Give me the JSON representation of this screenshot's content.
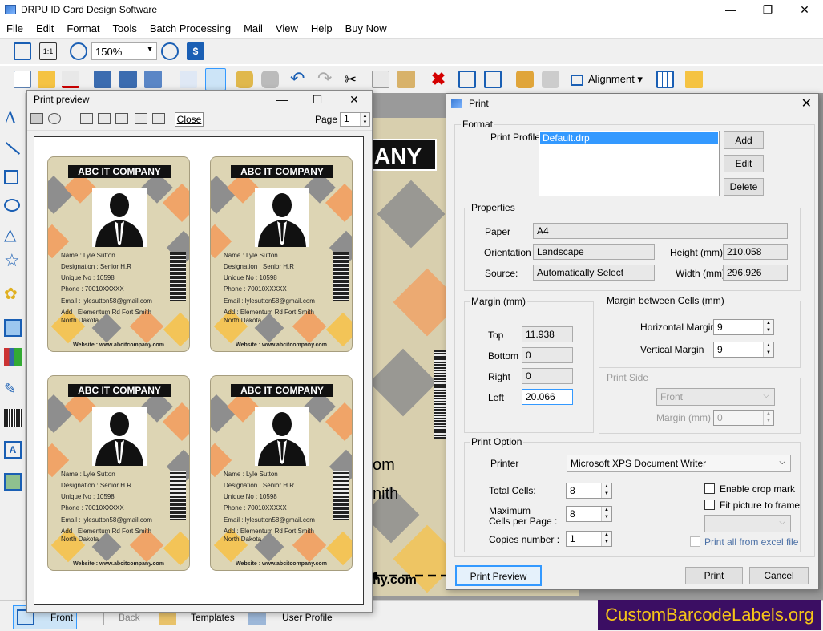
{
  "app": {
    "title": "DRPU ID Card Design Software",
    "menu": [
      "File",
      "Edit",
      "Format",
      "Tools",
      "Batch Processing",
      "Mail",
      "View",
      "Help",
      "Buy Now"
    ],
    "zoom": "150%",
    "alignment_label": "Alignment"
  },
  "background_card": {
    "header": "ANY",
    "line1": "om",
    "line2": "nith",
    "line3": "ny.com"
  },
  "bottom_tabs": [
    "Front",
    "Back",
    "Templates",
    "User Profile"
  ],
  "print_preview": {
    "title": "Print preview",
    "close_label": "Close",
    "page_label": "Page",
    "page_value": "1",
    "cards": [
      {
        "company": "ABC IT COMPANY",
        "name": "Name : Lyle Sutton",
        "designation": "Designation : Senior H.R",
        "unique": "Unique No : 10598",
        "phone": "Phone : 70010XXXXX",
        "email": "Email : lylesutton58@gmail.com",
        "address1": "Add : Elementum Rd Fort Smith",
        "address2": "North Dakota",
        "website": "Website : www.abcitcompany.com"
      }
    ]
  },
  "print_dialog": {
    "title": "Print",
    "format_label": "Format",
    "profile_label": "Print Profile",
    "profile_item": "Default.drp",
    "add_label": "Add",
    "edit_label": "Edit",
    "delete_label": "Delete",
    "properties_label": "Properties",
    "paper_label": "Paper",
    "paper_value": "A4",
    "orientation_label": "Orientation",
    "orientation_value": "Landscape",
    "source_label": "Source:",
    "source_value": "Automatically Select",
    "height_label": "Height (mm)",
    "height_value": "210.058",
    "width_label": "Width (mm)",
    "width_value": "296.926",
    "margin_label": "Margin (mm)",
    "top_label": "Top",
    "top_value": "11.938",
    "bottom_label": "Bottom",
    "bottom_value": "0",
    "right_label": "Right",
    "right_value": "0",
    "left_label": "Left",
    "left_value": "20.066",
    "cells_margin_label": "Margin between Cells (mm)",
    "hmargin_label": "Horizontal Margin",
    "hmargin_value": "9",
    "vmargin_label": "Vertical Margin",
    "vmargin_value": "9",
    "print_side_label": "Print Side",
    "print_side_value": "Front",
    "side_margin_label": "Margin (mm)",
    "side_margin_value": "0",
    "print_option_label": "Print Option",
    "printer_label": "Printer",
    "printer_value": "Microsoft XPS Document Writer",
    "total_cells_label": "Total Cells:",
    "total_cells_value": "8",
    "max_cells_label1": "Maximum",
    "max_cells_label2": "Cells per Page :",
    "max_cells_value": "8",
    "copies_label": "Copies number :",
    "copies_value": "1",
    "crop_label": "Enable crop mark",
    "fit_label": "Fit picture to frame",
    "excel_label": "Print all from excel file",
    "preview_btn": "Print Preview",
    "print_btn": "Print",
    "cancel_btn": "Cancel"
  },
  "watermark": "CustomBarcodeLabels.org"
}
